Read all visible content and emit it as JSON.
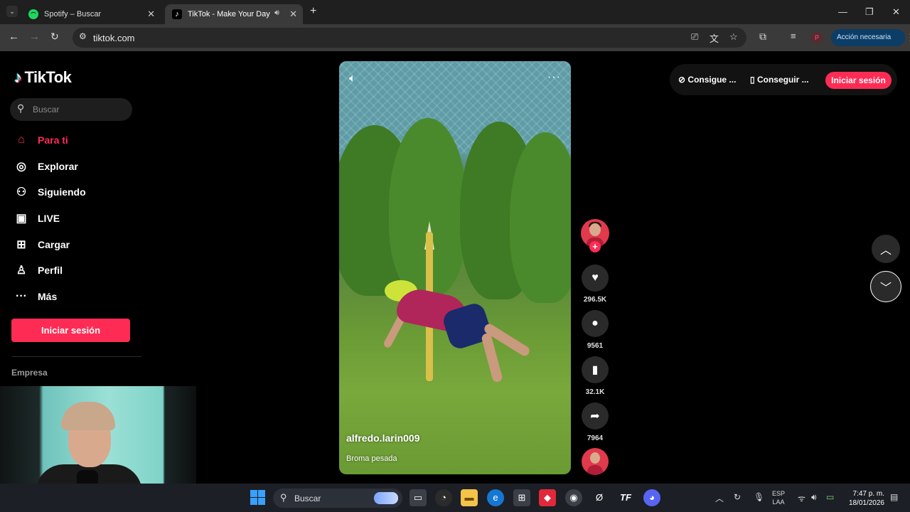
{
  "browser": {
    "tabs": [
      {
        "title": "Spotify – Buscar",
        "active": false
      },
      {
        "title": "TikTok - Make Your Day",
        "active": true
      }
    ],
    "url": "tiktok.com",
    "action_button": "Acción necesaria",
    "profile_initial": "P"
  },
  "sidebar": {
    "logo": "TikTok",
    "search_placeholder": "Buscar",
    "nav": [
      {
        "label": "Para ti",
        "icon": "home-icon",
        "active": true
      },
      {
        "label": "Explorar",
        "icon": "compass-icon",
        "active": false
      },
      {
        "label": "Siguiendo",
        "icon": "following-icon",
        "active": false
      },
      {
        "label": "LIVE",
        "icon": "live-icon",
        "active": false
      },
      {
        "label": "Cargar",
        "icon": "upload-icon",
        "active": false
      },
      {
        "label": "Perfil",
        "icon": "profile-icon",
        "active": false
      },
      {
        "label": "Más",
        "icon": "more-icon",
        "active": false
      }
    ],
    "login_button": "Iniciar sesión",
    "section_heading": "Empresa"
  },
  "top_right": {
    "link1": "Consigue ...",
    "link2": "Conseguir ...",
    "login_button": "Iniciar sesión"
  },
  "video": {
    "author": "alfredo.larin009",
    "caption": "Broma pesada",
    "likes": "296.5K",
    "comments": "9561",
    "saves": "32.1K",
    "shares": "7964"
  },
  "taskbar": {
    "search_placeholder": "Buscar",
    "language_top": "ESP",
    "language_bottom": "LAA",
    "time": "7:47 p. m.",
    "date": "18/01/2026"
  },
  "colors": {
    "brand": "#fe2c55",
    "background": "#000000"
  }
}
